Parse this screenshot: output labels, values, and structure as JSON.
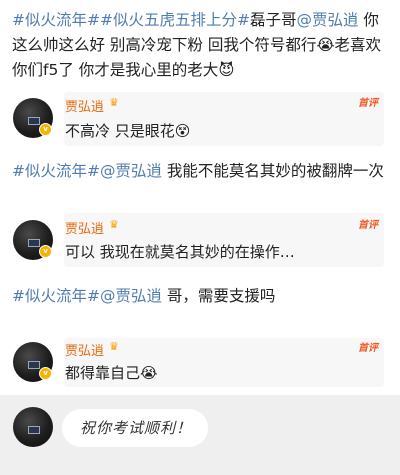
{
  "post1": {
    "tag1": "#似火流年#",
    "tag2": "#似火五虎五排上分#",
    "mention_prefix": "磊子哥",
    "mention": "@贾弘逍",
    "text1": " 你这么帅这么好 别高冷宠下粉 回我个符号都行",
    "emoji1": "😭",
    "text2": "老喜欢你们f5了 你才是我心里的老大",
    "emoji2": "😈"
  },
  "reply1": {
    "name": "贾弘逍",
    "badge": "首评",
    "text": "不高冷 只是眼花",
    "emoji": "😵"
  },
  "post2": {
    "tag": "#似火流年#",
    "mention": "@贾弘逍",
    "text": " 我能不能莫名其妙的被翻牌一次"
  },
  "reply2": {
    "name": "贾弘逍",
    "badge": "首评",
    "text": "可以 我现在就莫名其妙的在操作…"
  },
  "post3": {
    "tag": "#似火流年#",
    "mention": "@贾弘逍",
    "text": " 哥，需要支援吗"
  },
  "reply3": {
    "name": "贾弘逍",
    "badge": "首评",
    "text": "都得靠自己",
    "emoji": "😭"
  },
  "bottom": {
    "bubble_text": "祝你考试顺利！"
  },
  "icons": {
    "crown": "crown-icon",
    "verified": "verified-badge-icon"
  },
  "colors": {
    "tag": "#507daf",
    "name": "#e86b10",
    "badge": "#f05a28",
    "verified": "#f5b400"
  }
}
